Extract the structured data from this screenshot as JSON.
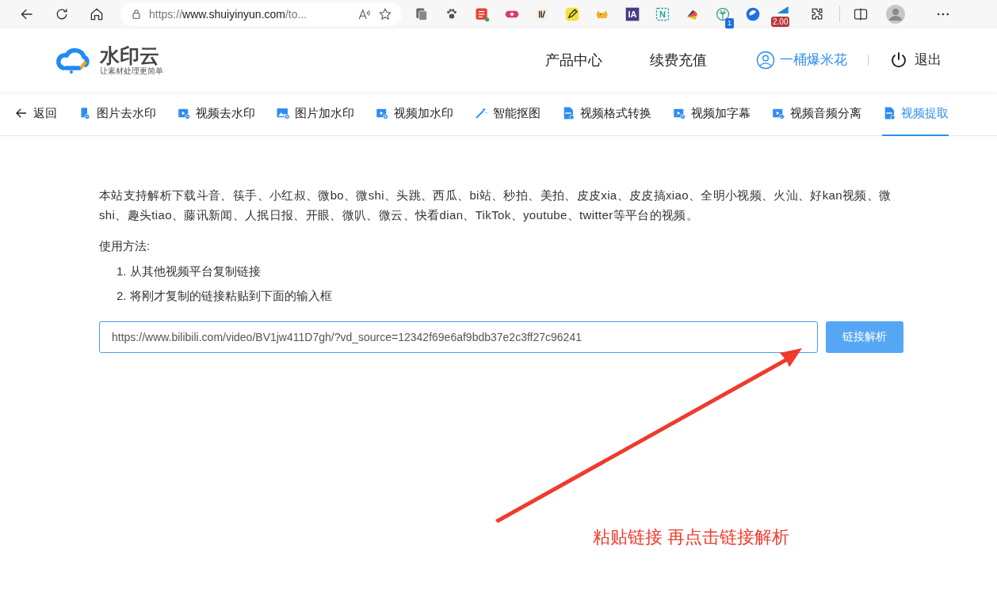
{
  "browser": {
    "url_scheme": "https://",
    "url_host": "www.shuiyinyun.com",
    "url_rest": "/to...",
    "extensions": [
      {
        "kind": "du"
      },
      {
        "kind": "ii"
      },
      {
        "kind": "pen"
      },
      {
        "kind": "cat"
      },
      {
        "kind": "ia",
        "label": "IA"
      },
      {
        "kind": "n",
        "label": "N"
      },
      {
        "kind": "fan"
      },
      {
        "kind": "palm",
        "badge": "1"
      },
      {
        "kind": "globe"
      },
      {
        "kind": "speed",
        "badge": "2.00"
      }
    ]
  },
  "site": {
    "logo_title": "水印云",
    "logo_slogan": "让素材处理更简单",
    "nav": [
      "产品中心",
      "续费充值"
    ],
    "user": "一桶爆米花",
    "logout": "退出"
  },
  "tabs": [
    {
      "label": "返回",
      "kind": "back",
      "selected": false
    },
    {
      "label": "图片去水印",
      "kind": "imageremove",
      "selected": false
    },
    {
      "label": "视频去水印",
      "kind": "videoremove",
      "selected": false
    },
    {
      "label": "图片加水印",
      "kind": "imageadd",
      "selected": false
    },
    {
      "label": "视频加水印",
      "kind": "videoadd",
      "selected": false
    },
    {
      "label": "智能抠图",
      "kind": "wand",
      "selected": false
    },
    {
      "label": "视频格式转换",
      "kind": "file",
      "selected": false
    },
    {
      "label": "视频加字幕",
      "kind": "videotext",
      "selected": false
    },
    {
      "label": "视频音频分离",
      "kind": "videoaudio",
      "selected": false
    },
    {
      "label": "视频提取",
      "kind": "file",
      "selected": true
    }
  ],
  "intro": "本站支持解析下载斗音、筷手、小红叔、微bo、微shi、头跳、西瓜、bi站、秒拍、美拍、皮皮xia、皮皮搞xiao、全明小视频、火汕、好kan视频、微shi、趣头tiao、藤讯新闻、人抿日报、开眼、微叭、微云、快看dian、TikTok、youtube、twitter等平台的视频。",
  "usage_title": "使用方法:",
  "steps": [
    "1. 从其他视频平台复制链接",
    "2. 将刚才复制的链接粘贴到下面的输入框"
  ],
  "link_input": {
    "value": "https://www.bilibili.com/video/BV1jw411D7gh/?vd_source=12342f69e6af9bdb37e2c3ff27c96241"
  },
  "parse_button": "链接解析",
  "annotation": "粘贴链接 再点击链接解析"
}
